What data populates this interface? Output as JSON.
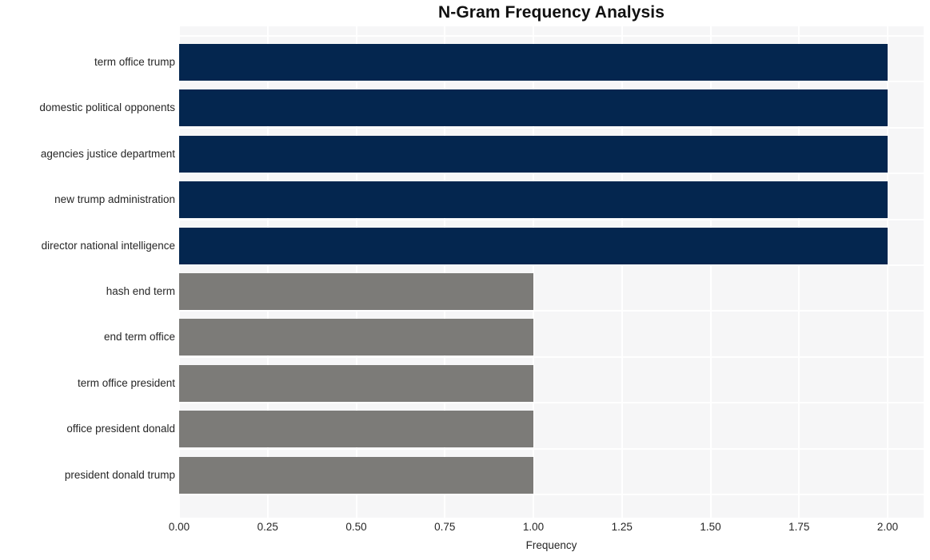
{
  "chart_data": {
    "type": "bar",
    "orientation": "horizontal",
    "title": "N-Gram Frequency Analysis",
    "xlabel": "Frequency",
    "ylabel": "",
    "xlim": [
      0,
      2
    ],
    "ylim": null,
    "grid": true,
    "legend": null,
    "xticks": [
      "0.00",
      "0.25",
      "0.50",
      "0.75",
      "1.00",
      "1.25",
      "1.50",
      "1.75",
      "2.00"
    ],
    "xtick_values": [
      0,
      0.25,
      0.5,
      0.75,
      1,
      1.25,
      1.5,
      1.75,
      2
    ],
    "categories": [
      "term office trump",
      "domestic political opponents",
      "agencies justice department",
      "new trump administration",
      "director national intelligence",
      "hash end term",
      "end term office",
      "term office president",
      "office president donald",
      "president donald trump"
    ],
    "values": [
      2,
      2,
      2,
      2,
      2,
      1,
      1,
      1,
      1,
      1
    ],
    "bar_colors": [
      "#04264f",
      "#04264f",
      "#04264f",
      "#04264f",
      "#04264f",
      "#7c7b78",
      "#7c7b78",
      "#7c7b78",
      "#7c7b78",
      "#7c7b78"
    ],
    "palette": {
      "high": "#04264f",
      "low": "#7c7b78",
      "plot_background": "#f6f6f7",
      "gridline": "#ffffff",
      "figure_background": "#ffffff",
      "text": "#262626",
      "title_text": "#111111"
    }
  }
}
